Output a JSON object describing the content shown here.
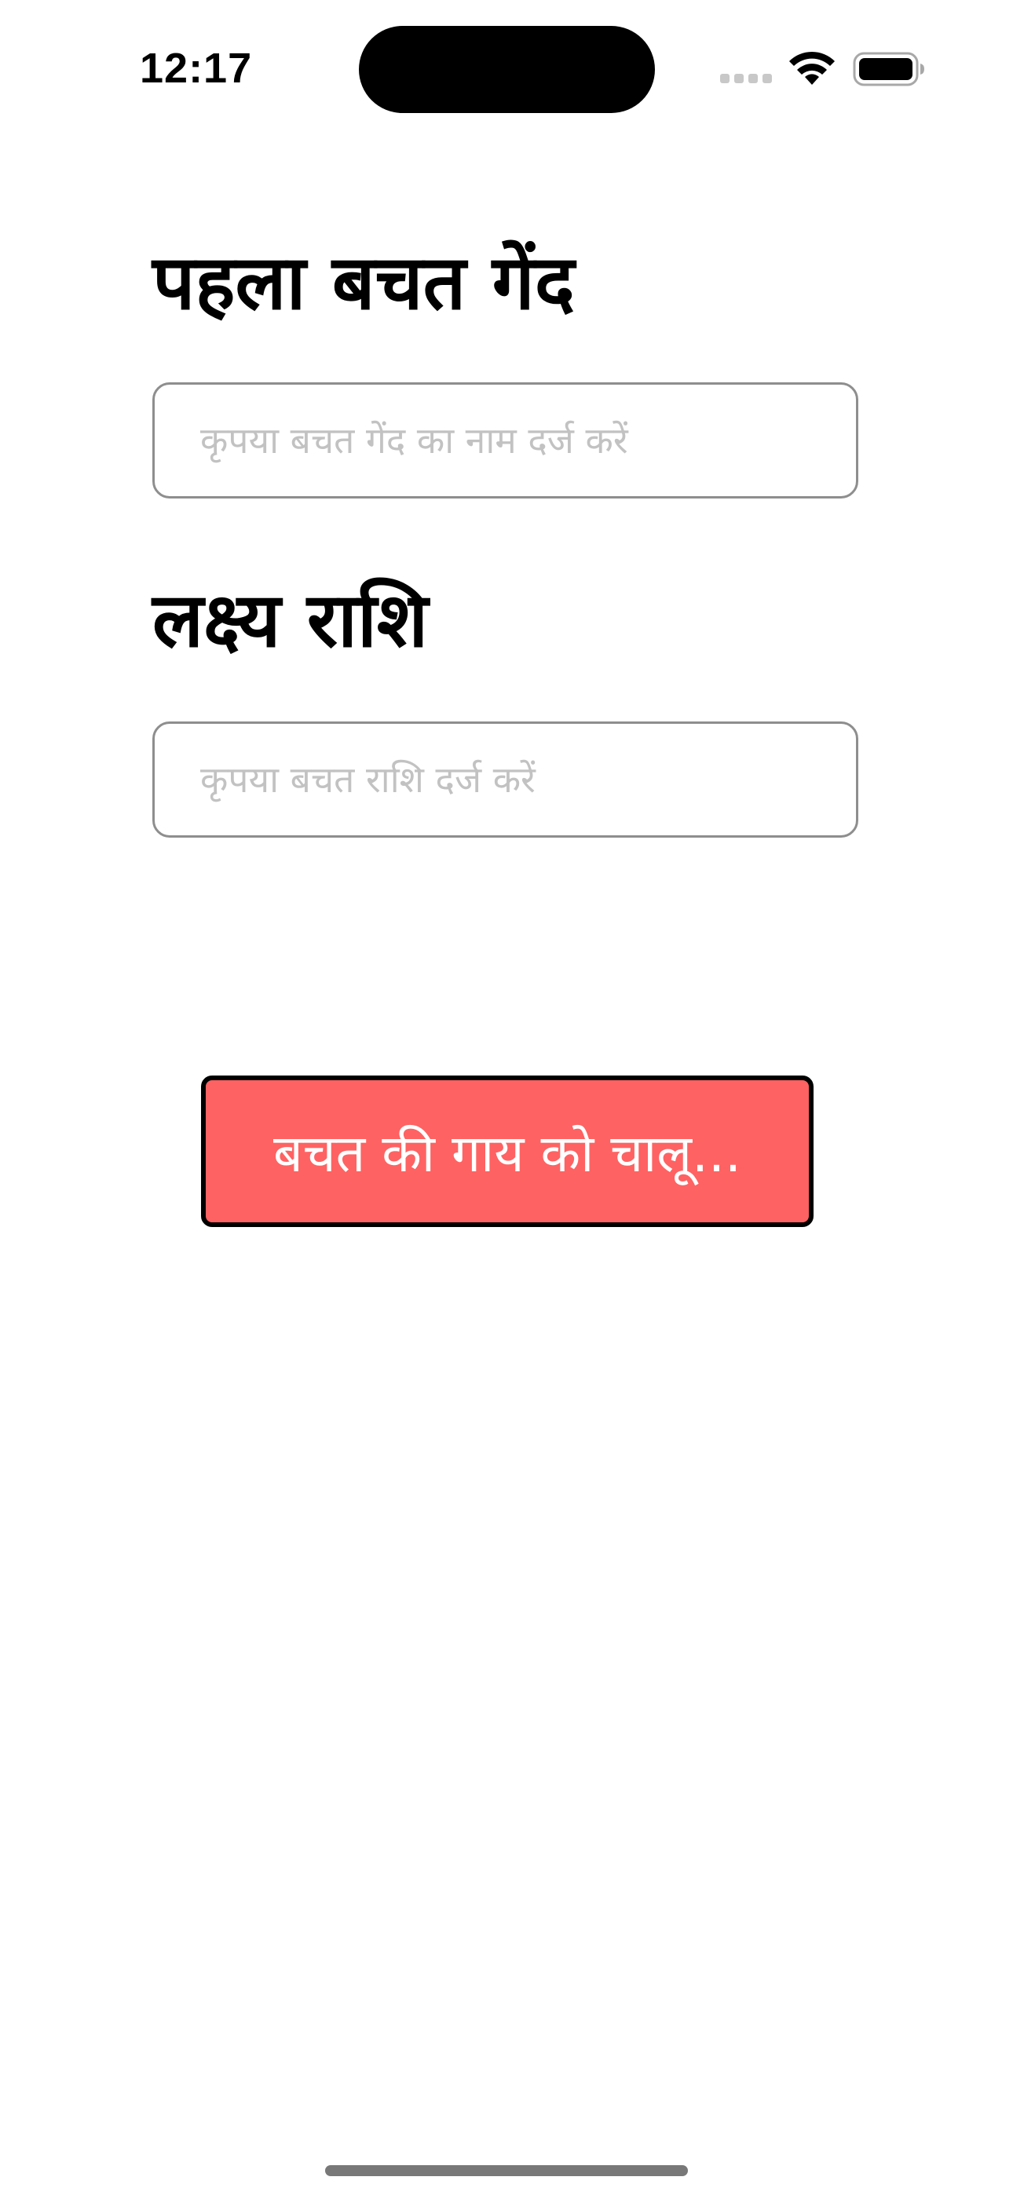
{
  "status_bar": {
    "time": "12:17",
    "icons": [
      "cellular-signal-icon",
      "wifi-icon",
      "battery-icon"
    ]
  },
  "form": {
    "goal_label": "पहला बचत गेंद",
    "goal_placeholder": "कृपया बचत गेंद का नाम दर्ज करें",
    "goal_value": "",
    "amount_label": "लक्ष्य राशि",
    "amount_placeholder": "कृपया बचत राशि दर्ज करें",
    "amount_value": ""
  },
  "button": {
    "label": "बचत की गाय को चालू...",
    "background_color": "#ff6262",
    "text_color": "#ffffff",
    "border_color": "#000000"
  }
}
